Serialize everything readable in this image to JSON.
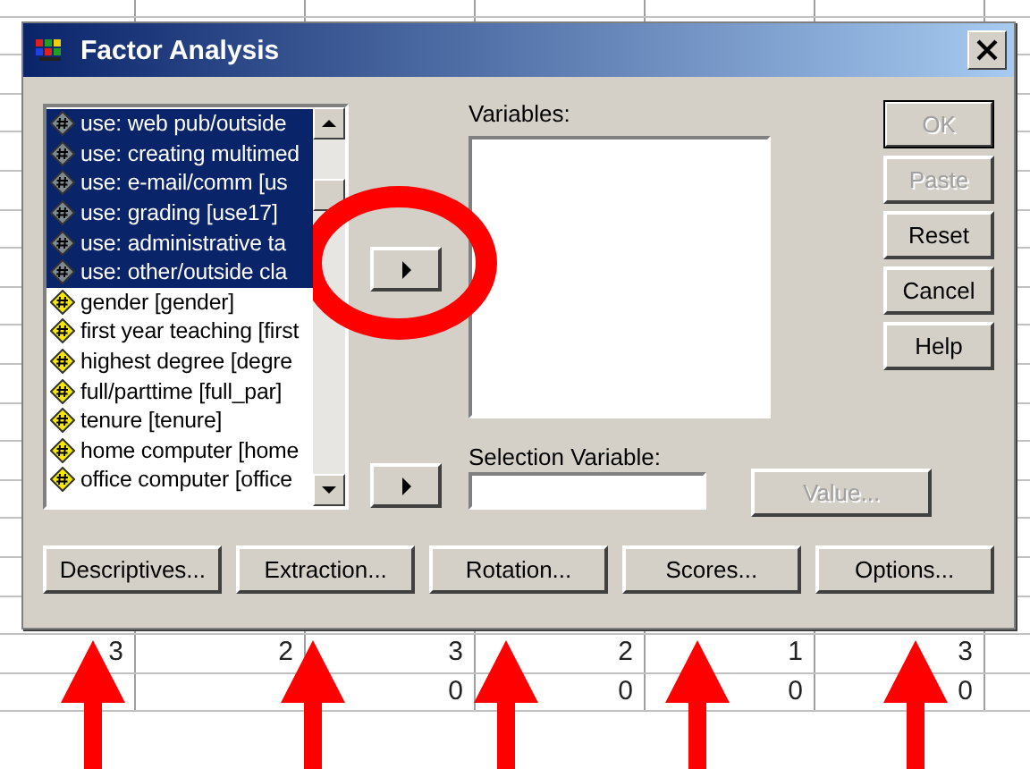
{
  "sheet": {
    "rows": [
      [
        "3",
        "2",
        "3",
        "2",
        "1",
        "3"
      ],
      [
        "",
        "",
        "0",
        "0",
        "0",
        "0"
      ]
    ]
  },
  "dialog": {
    "title": "Factor Analysis",
    "source_list": [
      {
        "label": "use: web pub/outside",
        "selected": true
      },
      {
        "label": "use: creating multimed",
        "selected": true
      },
      {
        "label": "use: e-mail/comm [us",
        "selected": true
      },
      {
        "label": "use: grading [use17]",
        "selected": true
      },
      {
        "label": "use: administrative ta",
        "selected": true
      },
      {
        "label": "use: other/outside cla",
        "selected": true
      },
      {
        "label": "gender [gender]",
        "selected": false
      },
      {
        "label": "first year teaching [first",
        "selected": false
      },
      {
        "label": "highest degree [degre",
        "selected": false
      },
      {
        "label": "full/parttime [full_par]",
        "selected": false
      },
      {
        "label": "tenure [tenure]",
        "selected": false
      },
      {
        "label": "home computer [home",
        "selected": false
      },
      {
        "label": "office computer [office",
        "selected": false
      }
    ],
    "variables_label": "Variables:",
    "selection_label": "Selection Variable:",
    "value_button": {
      "label": "Value...",
      "disabled": true
    },
    "side_buttons": [
      {
        "label": "OK",
        "disabled": true
      },
      {
        "label": "Paste",
        "disabled": true
      },
      {
        "label": "Reset",
        "disabled": false
      },
      {
        "label": "Cancel",
        "disabled": false
      },
      {
        "label": "Help",
        "disabled": false
      }
    ],
    "bottom_buttons": [
      {
        "label": "Descriptives...",
        "disabled": false
      },
      {
        "label": "Extraction...",
        "disabled": false
      },
      {
        "label": "Rotation...",
        "disabled": false
      },
      {
        "label": "Scores...",
        "disabled": false
      },
      {
        "label": "Options...",
        "disabled": false
      }
    ]
  },
  "annotations": [
    {
      "kind": "ring"
    },
    {
      "kind": "arrow"
    },
    {
      "kind": "arrow"
    },
    {
      "kind": "arrow"
    },
    {
      "kind": "arrow"
    },
    {
      "kind": "arrow"
    }
  ]
}
